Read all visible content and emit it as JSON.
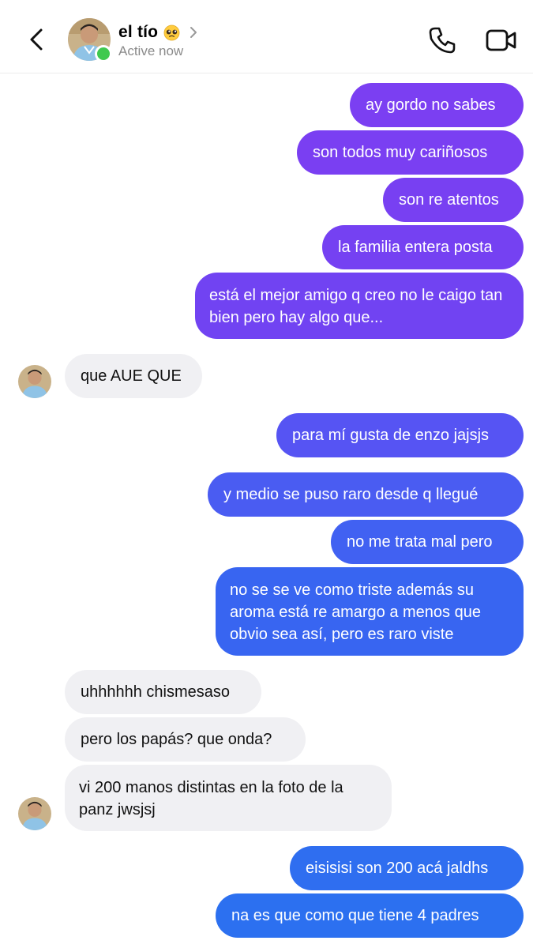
{
  "header": {
    "contact_name": "el tío",
    "status": "Active now",
    "emoji": "pleading-face-emoji"
  },
  "colors": {
    "purple": "#7b3ff2",
    "blue": "#2f6cf0",
    "incoming_bg": "#f0f0f3",
    "online": "#3fc94f"
  },
  "messages": [
    {
      "dir": "out",
      "text": "ay gordo no sabes"
    },
    {
      "dir": "out",
      "text": "son todos muy cariñosos"
    },
    {
      "dir": "out",
      "text": "son re atentos"
    },
    {
      "dir": "out",
      "text": "la familia entera posta"
    },
    {
      "dir": "out",
      "text": "está el mejor amigo q creo no le caigo tan bien pero hay algo que..."
    },
    {
      "dir": "in",
      "text": "que AUE QUE"
    },
    {
      "dir": "out",
      "text": "para mí gusta de enzo jajsjs"
    },
    {
      "dir": "out",
      "text": "y medio se puso raro desde q llegué"
    },
    {
      "dir": "out",
      "text": "no me trata mal pero"
    },
    {
      "dir": "out",
      "text": "no se se ve como triste además su aroma está re amargo a menos que obvio sea así, pero es raro viste"
    },
    {
      "dir": "in",
      "text": "uhhhhhh chismesaso"
    },
    {
      "dir": "in",
      "text": "pero los papás? que onda?"
    },
    {
      "dir": "in",
      "text": "vi 200 manos distintas en la foto de la panz jwsjsj"
    },
    {
      "dir": "out",
      "text": "eisisisi son 200 acá jaldhs"
    },
    {
      "dir": "out",
      "text": "na es que como que tiene 4 padres"
    }
  ]
}
